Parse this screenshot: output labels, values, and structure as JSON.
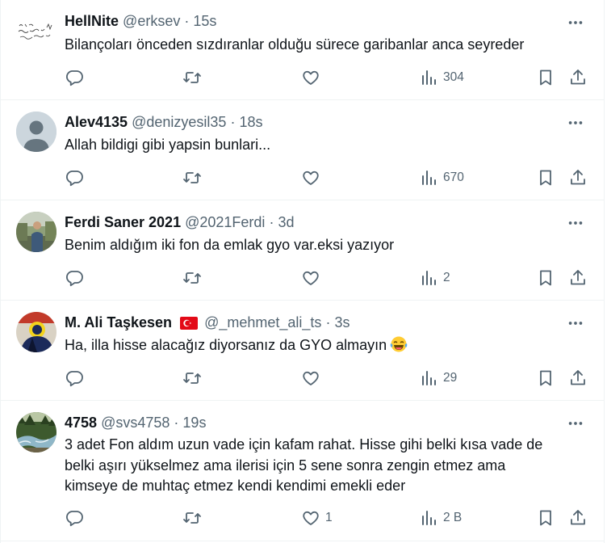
{
  "tweets": [
    {
      "name": "HellNite",
      "handle": "@erksev",
      "time": "15s",
      "text": "Bilançoları önceden sızdıranlar olduğu sürece garibanlar anca seyreder",
      "replies": "",
      "retweets": "",
      "likes": "",
      "views": "304",
      "avatar": "handwritten-avatar"
    },
    {
      "name": "Alev4135",
      "handle": "@denizyesil35",
      "time": "18s",
      "text": "Allah bildigi gibi yapsin bunlari...",
      "replies": "",
      "retweets": "",
      "likes": "",
      "views": "670",
      "avatar": "default-avatar"
    },
    {
      "name": "Ferdi Saner 2021",
      "handle": "@2021Ferdi",
      "time": "3d",
      "text": "Benim aldığım iki fon da emlak gyo var.eksi yazıyor",
      "replies": "",
      "retweets": "",
      "likes": "",
      "views": "2",
      "avatar": "photo-avatar"
    },
    {
      "name": "M. Ali Taşkesen",
      "handle": "@_mehmet_ali_ts",
      "time": "3s",
      "text": "Ha, illa hisse alacağız diyorsanız da GYO almayın",
      "emoji": "face-with-tears-of-joy",
      "flag": "turkey-flag",
      "replies": "",
      "retweets": "",
      "likes": "",
      "views": "29",
      "avatar": "fenerbahce-avatar"
    },
    {
      "name": "4758",
      "handle": "@svs4758",
      "time": "19s",
      "text_lines": [
        "3 adet Fon aldım uzun vade için kafam rahat. Hisse gihi belki kısa vade de",
        "belki aşırı yükselmez ama ilerisi için 5 sene sonra zengin etmez ama",
        "kimseye de muhtaç etmez kendi kendimi emekli eder"
      ],
      "replies": "",
      "retweets": "",
      "likes": "1",
      "views": "2 B",
      "avatar": "river-avatar"
    }
  ],
  "separator": "·",
  "colors": {
    "text": "#0f1419",
    "secondary": "#536471",
    "border": "#eff3f4",
    "flag_red": "#e30a17"
  }
}
